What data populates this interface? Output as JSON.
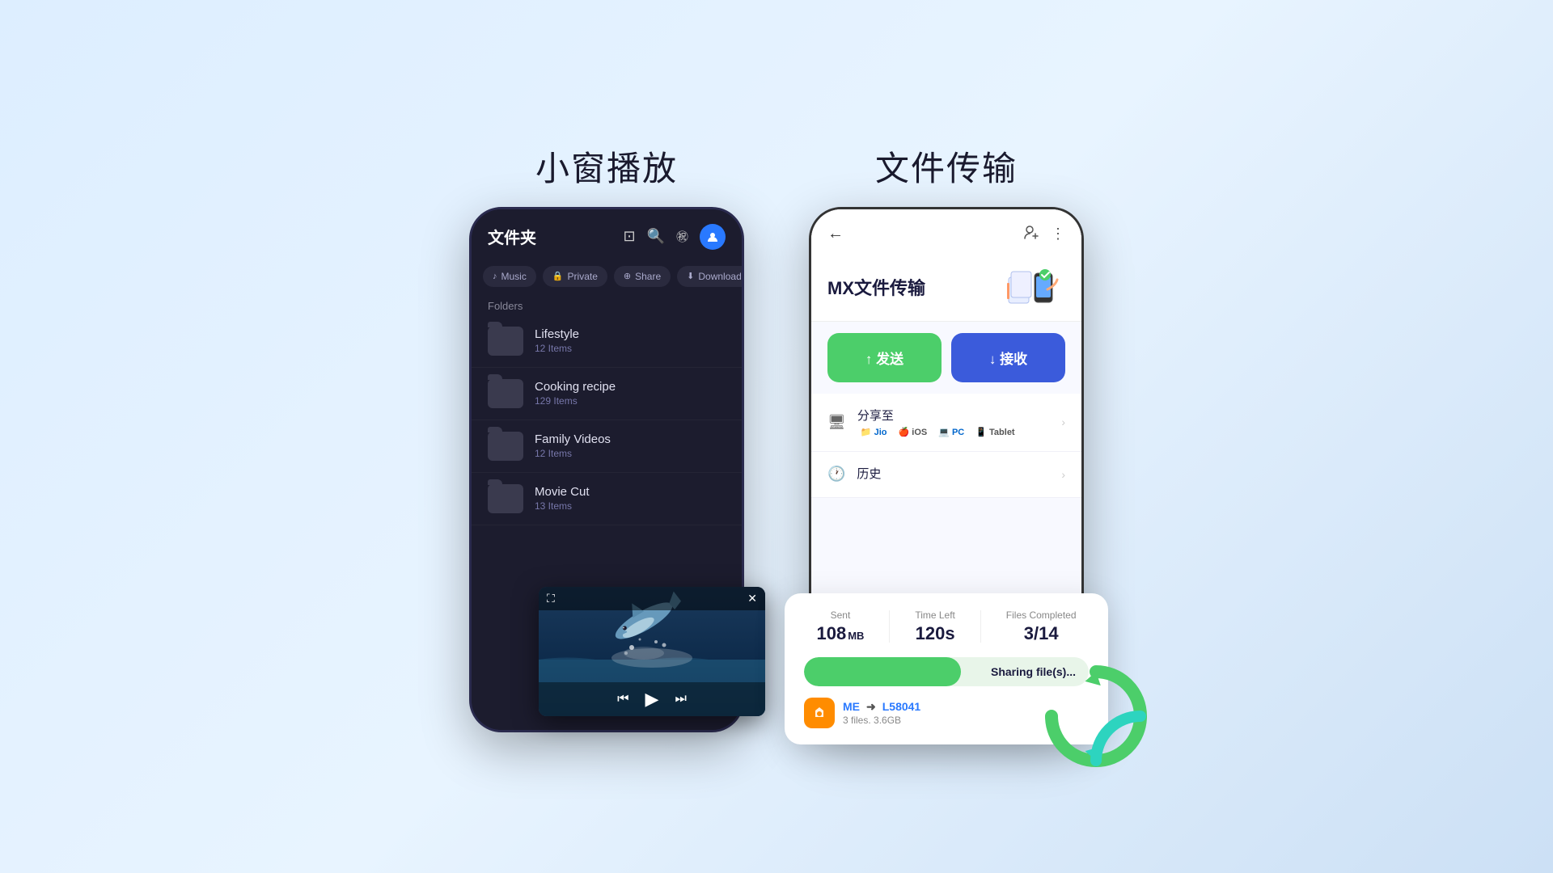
{
  "left_section": {
    "title": "小窗播放",
    "phone": {
      "header": {
        "title": "文件夹",
        "icons": [
          "cast",
          "search",
          "subtitle",
          "profile"
        ]
      },
      "tabs": [
        {
          "icon": "♪",
          "label": "Music"
        },
        {
          "icon": "🔒",
          "label": "Private"
        },
        {
          "icon": "⊕",
          "label": "Share"
        },
        {
          "icon": "⬇",
          "label": "Downloads"
        }
      ],
      "folders_label": "Folders",
      "folders": [
        {
          "name": "Lifestyle",
          "count": "12 Items"
        },
        {
          "name": "Cooking recipe",
          "count": "129 Items"
        },
        {
          "name": "Family Videos",
          "count": "12 Items"
        },
        {
          "name": "Movie Cut",
          "count": "13 Items"
        }
      ],
      "mini_player": {
        "expand_icon": "⛶",
        "close_icon": "✕",
        "controls": [
          "⏮",
          "▶",
          "⏭"
        ]
      }
    }
  },
  "right_section": {
    "title": "文件传输",
    "phone": {
      "header": {
        "back": "←",
        "icons": [
          "add-user",
          "more"
        ]
      },
      "mx_title": "MX文件传输",
      "send_btn": "↑ 发送",
      "receive_btn": "↓ 接收",
      "share_section": {
        "title": "分享至",
        "platforms": [
          "Jio",
          "iOS",
          "PC",
          "Tablet"
        ]
      },
      "history_section": {
        "title": "历史"
      }
    },
    "transfer_card": {
      "sent_label": "Sent",
      "sent_value": "108",
      "sent_unit": "MB",
      "time_label": "Time Left",
      "time_value": "120s",
      "files_label": "Files Completed",
      "files_value": "3/14",
      "progress_text": "Sharing file(s)...",
      "progress_percent": 55,
      "peer_from": "ME",
      "peer_to": "L58041",
      "peer_detail": "3 files. 3.6GB"
    }
  }
}
